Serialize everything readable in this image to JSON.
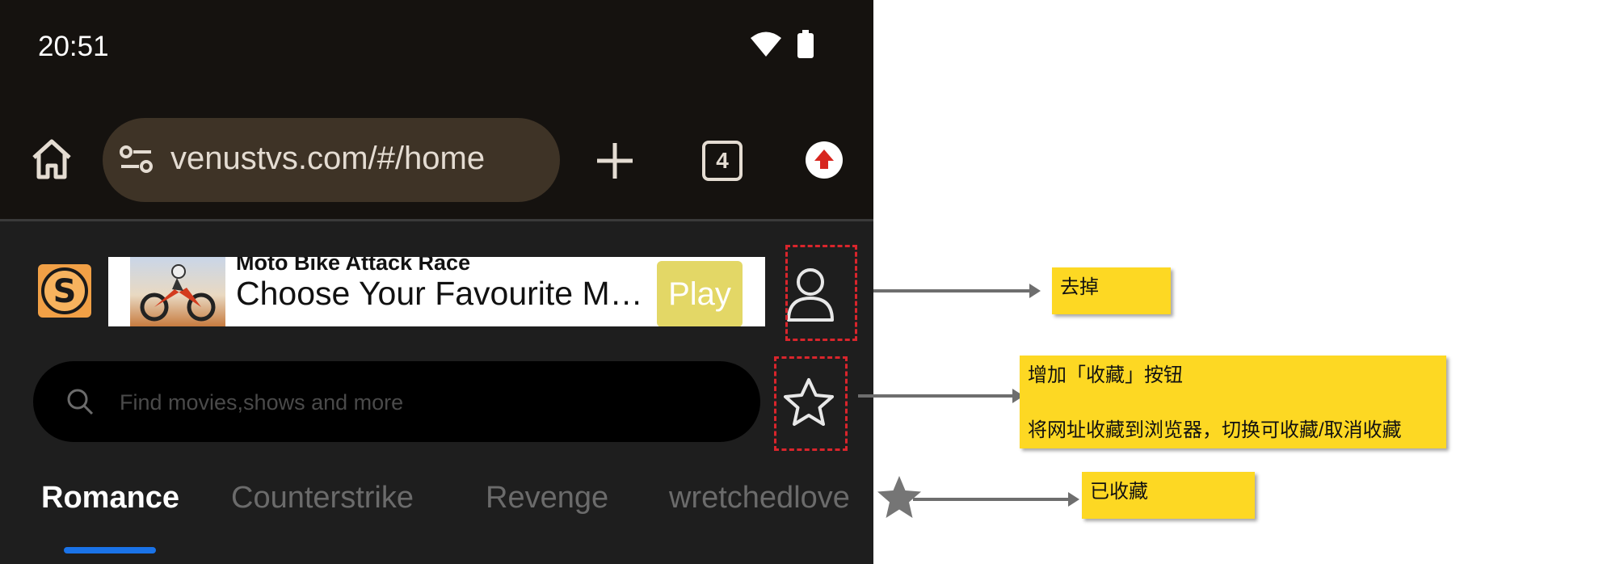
{
  "status_bar": {
    "time": "20:51"
  },
  "browser": {
    "url": "venustvs.com/#/home",
    "tab_count": "4"
  },
  "ad": {
    "small_title": "Moto Bike Attack Race",
    "headline": "Choose Your Favourite Mo…",
    "play_label": "Play"
  },
  "search": {
    "placeholder": "Find movies,shows and more"
  },
  "categories": [
    "Romance",
    "Counterstrike",
    "Revenge",
    "wretchedlove"
  ],
  "annotations": {
    "remove_note": "去掉",
    "add_favorite_note": {
      "title": "增加「收藏」按钮",
      "description": "将网址收藏到浏览器，切换可收藏/取消收藏"
    },
    "favorited_note": "已收藏"
  },
  "colors": {
    "accent_blue": "#1a73e8",
    "note_yellow": "#fdd823",
    "annotation_red": "#d9252c",
    "play_button": "#e3d766"
  }
}
